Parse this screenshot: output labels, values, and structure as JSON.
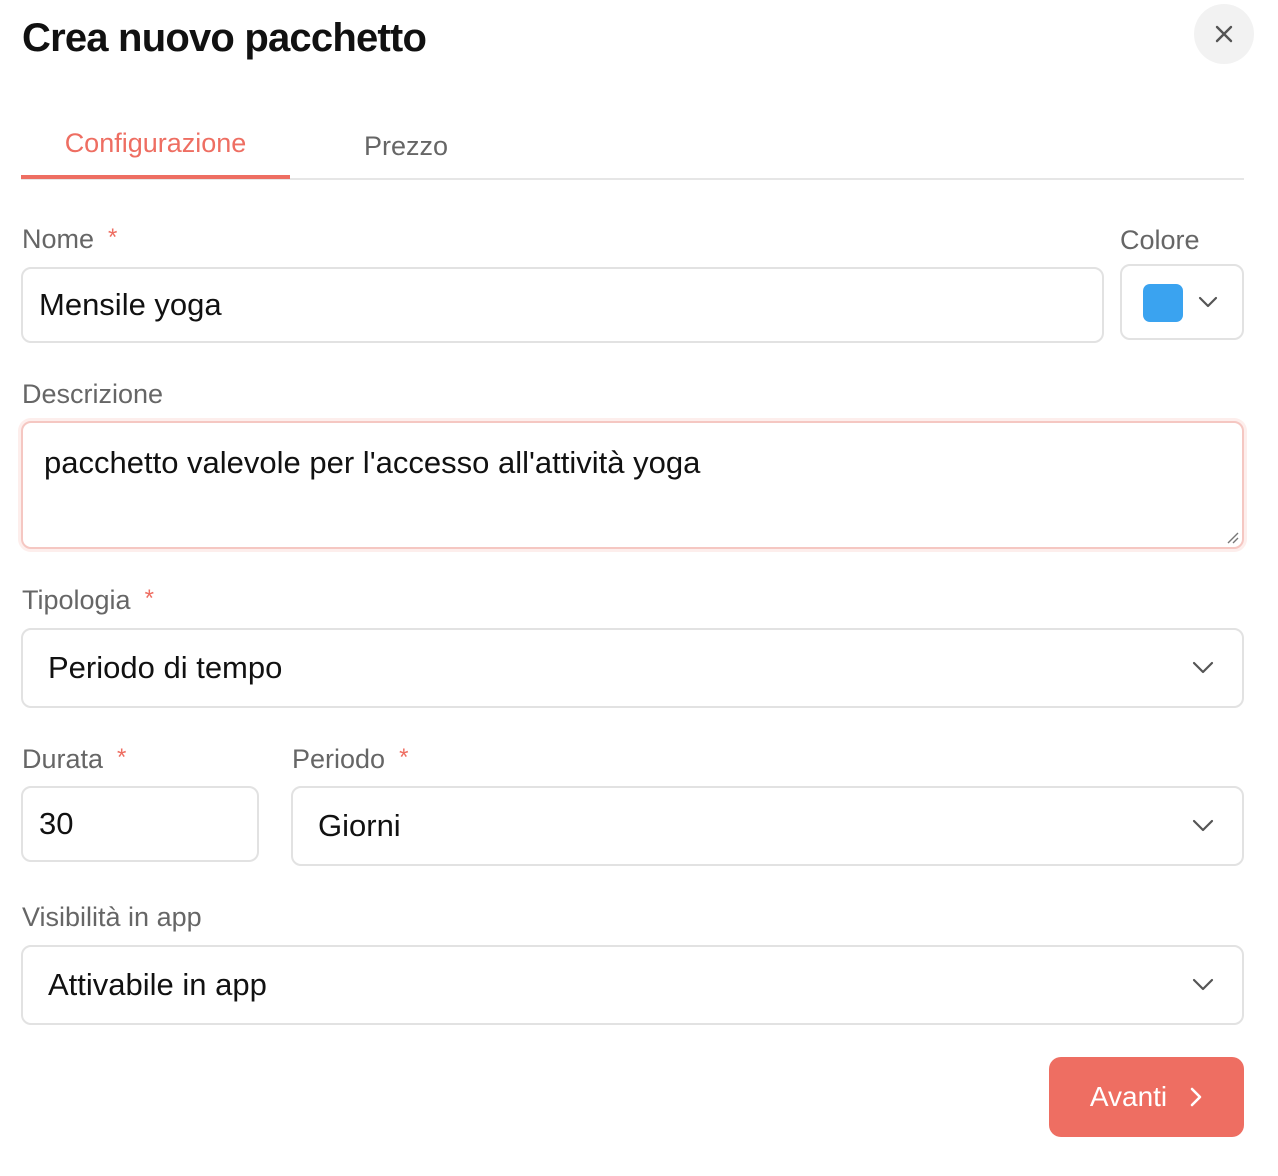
{
  "dialog": {
    "title": "Crea nuovo pacchetto",
    "close_icon": "close-icon"
  },
  "tabs": [
    {
      "label": "Configurazione",
      "active": true
    },
    {
      "label": "Prezzo",
      "active": false
    }
  ],
  "form": {
    "nome": {
      "label": "Nome",
      "required_mark": "*",
      "value": "Mensile yoga"
    },
    "colore": {
      "label": "Colore",
      "value_color": "#3aa3f0"
    },
    "descrizione": {
      "label": "Descrizione",
      "value": "pacchetto valevole per l'accesso all'attività yoga"
    },
    "tipologia": {
      "label": "Tipologia",
      "required_mark": "*",
      "value": "Periodo di tempo"
    },
    "durata": {
      "label": "Durata",
      "required_mark": "*",
      "value": "30"
    },
    "periodo": {
      "label": "Periodo",
      "required_mark": "*",
      "value": "Giorni"
    },
    "visibilita": {
      "label": "Visibilità in app",
      "value": "Attivabile in app"
    }
  },
  "actions": {
    "next_label": "Avanti",
    "next_icon": "chevron-right-icon"
  },
  "colors": {
    "accent": "#ee6e62",
    "border": "#e2e2e2",
    "label_text": "#666666"
  }
}
